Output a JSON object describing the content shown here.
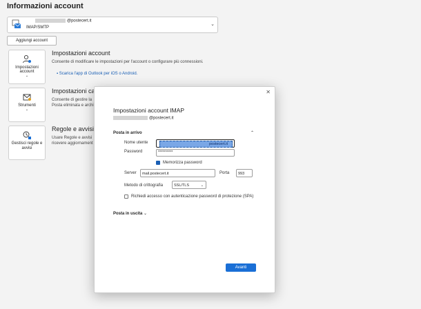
{
  "page": {
    "title": "Informazioni account"
  },
  "account_selector": {
    "email_suffix": "@postecert.it",
    "type": "IMAP/SMTP"
  },
  "add_account_button": "Aggiungi account",
  "sections": {
    "account_settings": {
      "tile_label": "Impostazioni account",
      "heading": "Impostazioni account",
      "desc": "Consente di modificare le impostazioni per l'account o configurare più connessioni.",
      "link": "Scarica l'app di Outlook per iOS o Android."
    },
    "tools": {
      "tile_label": "Strumenti",
      "heading": "Impostazioni casella",
      "desc_line1": "Consente di gestire la",
      "desc_line2": "Posta eliminata e archi"
    },
    "rules": {
      "tile_label": "Gestisci regole e avvisi",
      "heading": "Regole e avvisi",
      "desc_line1": "Usare Regole e avvisi",
      "desc_line2": "ricevere aggiornament"
    }
  },
  "dialog": {
    "title": "Impostazioni account IMAP",
    "email_suffix": "@postecert.it",
    "incoming": {
      "section_label": "Posta in arrivo",
      "username_label": "Nome utente",
      "username_value": "postecert.it",
      "password_label": "Password",
      "password_value": "**********",
      "remember_label": "Memorizza password",
      "remember_checked": true,
      "server_label": "Server",
      "server_value": "mail.postecert.it",
      "port_label": "Porta",
      "port_value": "993",
      "encryption_label": "Metodo di crittografia",
      "encryption_value": "SSL/TLS",
      "spa_label": "Richiedi accesso con autenticazione password di protezione (SPA)",
      "spa_checked": false
    },
    "outgoing": {
      "section_label": "Posta in uscita"
    },
    "next_button": "Avanti"
  },
  "colors": {
    "accent": "#1a6fd6",
    "selection": "#7aa7e6",
    "background": "#f3f3f3"
  }
}
